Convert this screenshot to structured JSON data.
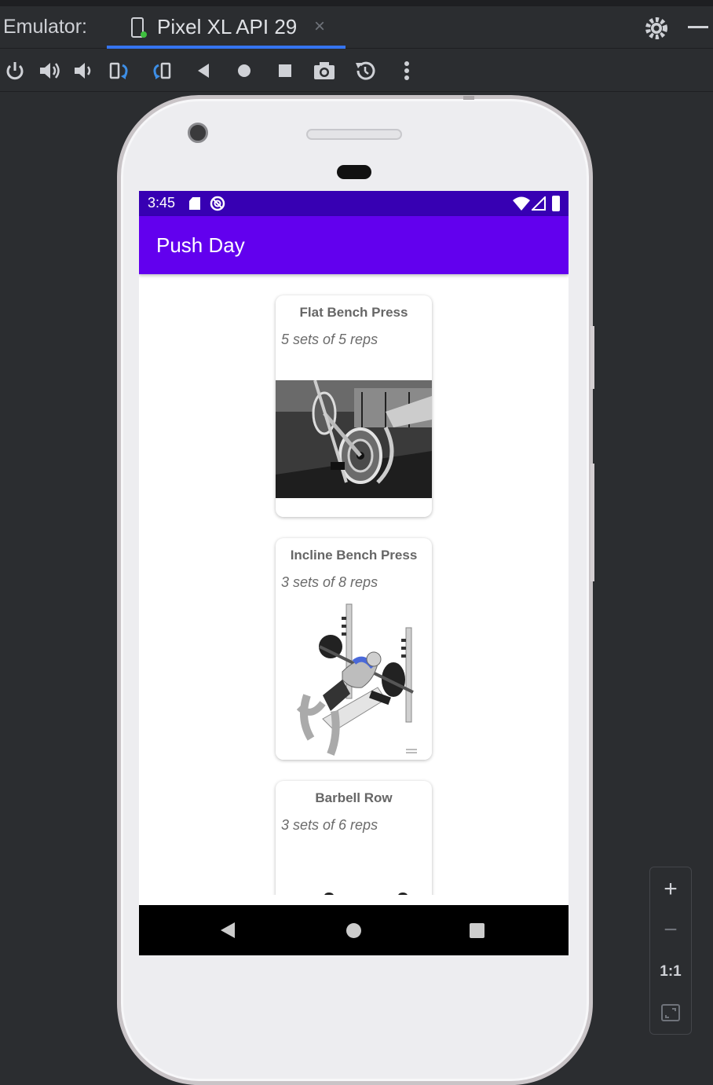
{
  "ide": {
    "emulator_label": "Emulator:",
    "tab_title": "Pixel XL API 29",
    "tab_close": "×",
    "toolbar_icons": [
      "power-icon",
      "volume-up-icon",
      "volume-down-icon",
      "rotate-left-icon",
      "rotate-right-icon",
      "back-icon",
      "home-icon",
      "overview-icon",
      "camera-icon",
      "snapshot-icon",
      "more-icon"
    ],
    "zoom": {
      "plus": "+",
      "minus": "−",
      "one_to_one": "1:1"
    }
  },
  "device": {
    "status": {
      "time": "3:45"
    },
    "app_title": "Push Day",
    "exercises": [
      {
        "name": "Flat Bench Press",
        "detail": "5 sets of 5 reps"
      },
      {
        "name": "Incline Bench Press",
        "detail": "3 sets of 8 reps"
      },
      {
        "name": "Barbell Row",
        "detail": "3 sets of 6 reps"
      }
    ]
  },
  "colors": {
    "status_bar": "#3700b3",
    "app_bar": "#6200ee",
    "tab_accent": "#3574f0"
  }
}
